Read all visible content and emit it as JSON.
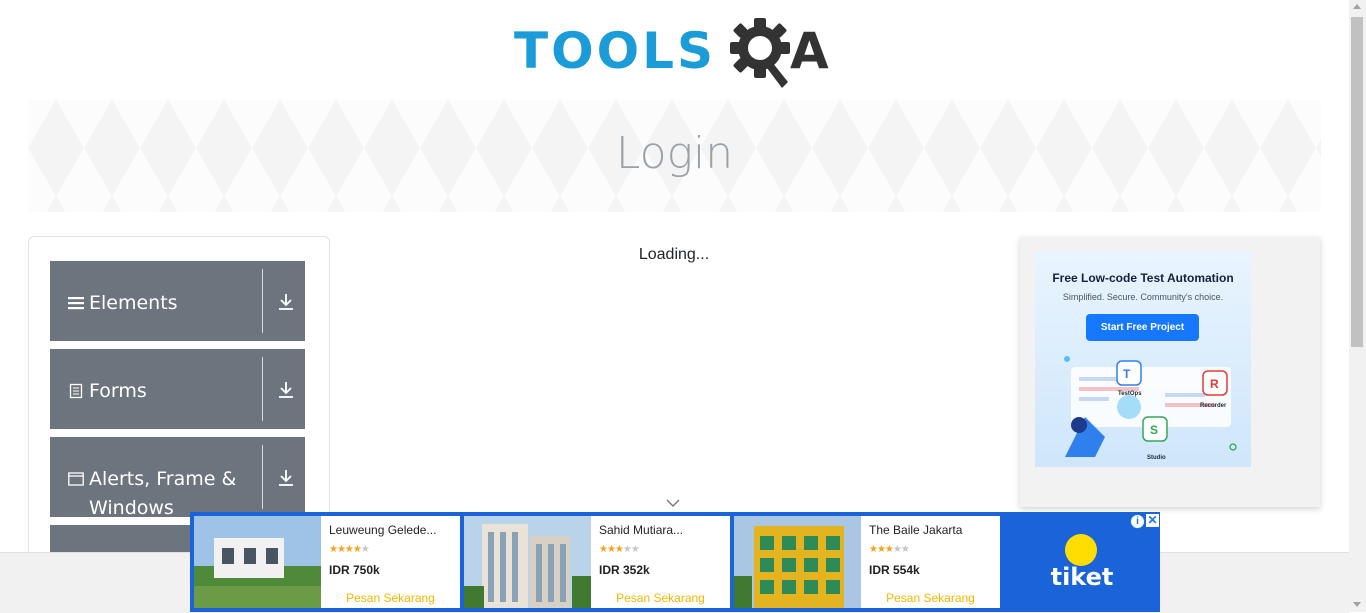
{
  "header": {
    "logo_text_left": "TOOLS",
    "logo_text_right": "A",
    "logo_icon": "gear-magnifier-icon"
  },
  "banner": {
    "title": "Login"
  },
  "sidebar": {
    "groups": [
      {
        "label": "Elements",
        "icon": "hamburger-icon",
        "toggle_icon": "download-arrow-icon"
      },
      {
        "label": "Forms",
        "icon": "document-icon",
        "toggle_icon": "download-arrow-icon"
      },
      {
        "label": "Alerts, Frame & Windows",
        "icon": "window-icon",
        "toggle_icon": "download-arrow-icon"
      }
    ]
  },
  "main": {
    "status_text": "Loading...",
    "scroll_hint_icon": "chevron-down-icon"
  },
  "right_ad": {
    "headline": "Free Low-code Test Automation",
    "subline": "Simplified. Secure. Community's choice.",
    "button_label": "Start Free Project",
    "products": [
      "TestOps",
      "Recorder",
      "Studio"
    ]
  },
  "bottom_ad": {
    "brand": "tiket",
    "info_icon": "info-icon",
    "close_icon": "close-icon",
    "hotels": [
      {
        "name": "Leuweung Gelede...",
        "rating": 4,
        "max_rating": 5,
        "price": "IDR 750k",
        "cta": "Pesan Sekarang"
      },
      {
        "name": "Sahid Mutiara...",
        "rating": 3,
        "max_rating": 5,
        "price": "IDR 352k",
        "cta": "Pesan Sekarang"
      },
      {
        "name": "The Baile Jakarta",
        "rating": 3,
        "max_rating": 5,
        "price": "IDR 554k",
        "cta": "Pesan Sekarang"
      }
    ]
  },
  "colors": {
    "brand_blue": "#1b9bd7",
    "brand_dark": "#333333",
    "sidebar_bg": "#6c757d",
    "ad_blue": "#1a63d8",
    "cta_yellow": "#f7b500",
    "star": "#f7a21b"
  }
}
